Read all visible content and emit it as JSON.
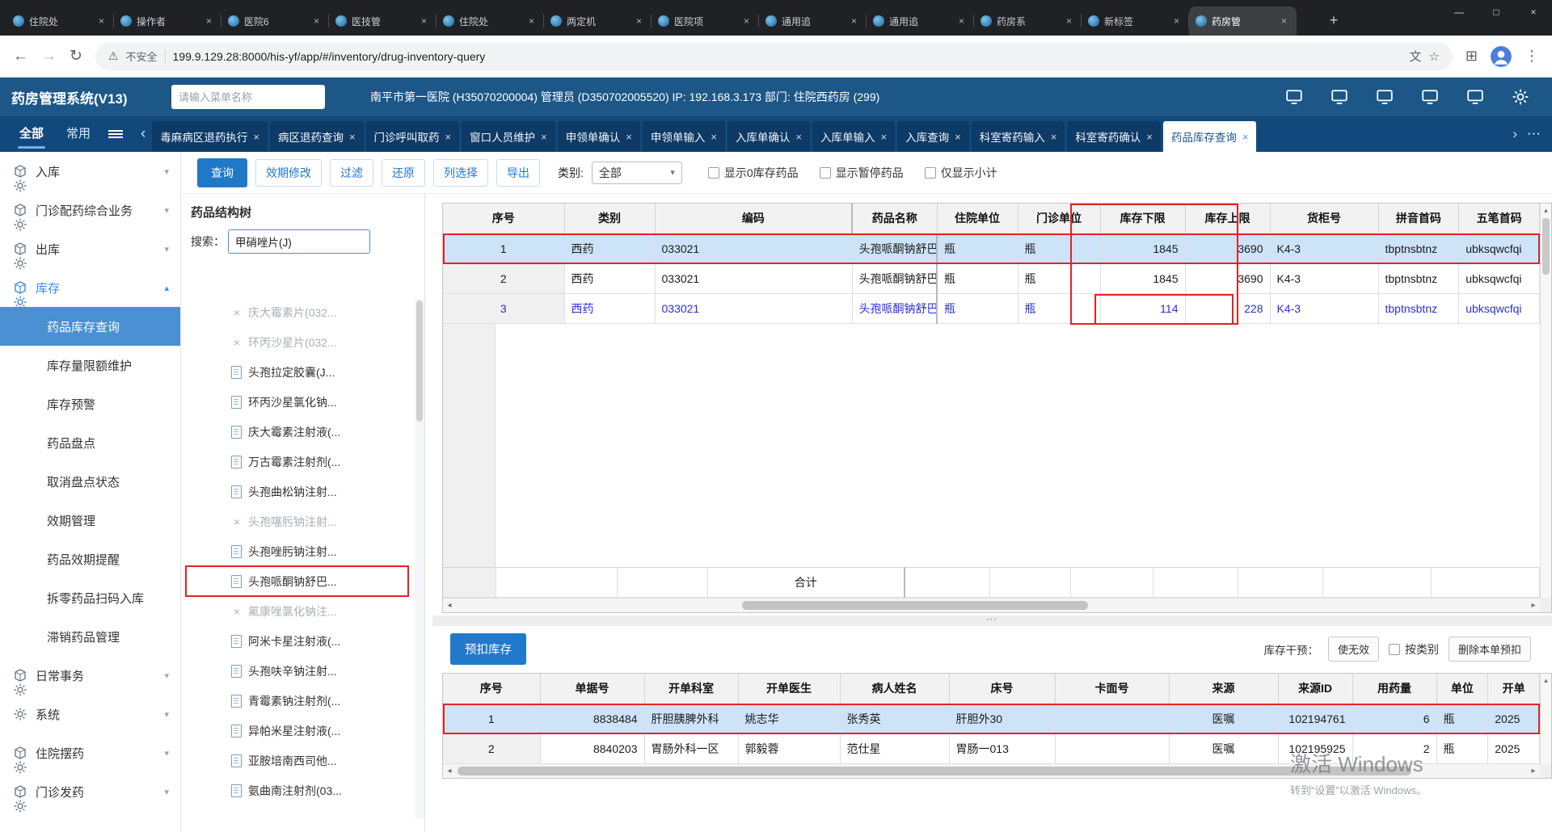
{
  "browser": {
    "tabs": [
      {
        "title": "住院处"
      },
      {
        "title": "操作者"
      },
      {
        "title": "医院6"
      },
      {
        "title": "医技管"
      },
      {
        "title": "住院处"
      },
      {
        "title": "两定机"
      },
      {
        "title": "医院项"
      },
      {
        "title": "通用追"
      },
      {
        "title": "通用追"
      },
      {
        "title": "药房系"
      },
      {
        "title": "新标签"
      },
      {
        "title": "药房管",
        "active": true
      }
    ],
    "new_tab_label": "+",
    "window_controls": {
      "minimize": "—",
      "maximize": "□",
      "close": "×"
    },
    "address": {
      "security_label": "不安全",
      "url": "199.9.129.28:8000/his-yf/app/#/inventory/drug-inventory-query"
    }
  },
  "icons": {
    "back": "←",
    "forward": "→",
    "refresh": "↻",
    "warning": "⚠",
    "star": "☆",
    "extensions": "⊞",
    "menu_dots": "⋮",
    "translate": "文",
    "caret_down": "▾",
    "chevron_left": "‹",
    "chevron_right": "›",
    "more": "⋯",
    "scroll_up": "▴",
    "scroll_left": "◂",
    "scroll_right": "▸"
  },
  "app_header": {
    "title": "药房管理系统(V13)",
    "menu_search_placeholder": "请输入菜单名称",
    "session_info": "南平市第一医院 (H35070200004) 管理员 (D350702005520) IP: 192.168.3.173 部门: 住院西药房 (299)",
    "icons": [
      {
        "name": "cast-icon"
      },
      {
        "name": "monitor-icon"
      },
      {
        "name": "voice-icon"
      },
      {
        "name": "kiosk-icon"
      },
      {
        "name": "browser-icon"
      },
      {
        "name": "settings-icon",
        "gear": true
      }
    ]
  },
  "menu_bar": {
    "filters": [
      {
        "label": "全部",
        "active": true
      },
      {
        "label": "常用"
      }
    ],
    "tabs": [
      {
        "label": "毒麻病区退药执行"
      },
      {
        "label": "病区退药查询"
      },
      {
        "label": "门诊呼叫取药"
      },
      {
        "label": "窗口人员维护"
      },
      {
        "label": "申领单确认"
      },
      {
        "label": "申领单输入"
      },
      {
        "label": "入库单确认"
      },
      {
        "label": "入库单输入"
      },
      {
        "label": "入库查询"
      },
      {
        "label": "科室寄药输入"
      },
      {
        "label": "科室寄药确认"
      },
      {
        "label": "药品库存查询",
        "active": true
      }
    ]
  },
  "sidebar": {
    "items": [
      {
        "label": "入库"
      },
      {
        "label": "门诊配药综合业务"
      },
      {
        "label": "出库"
      },
      {
        "label": "库存",
        "expanded": true
      },
      {
        "label": "药品库存查询",
        "sub": true,
        "active": true
      },
      {
        "label": "库存量限额维护",
        "sub": true
      },
      {
        "label": "库存预警",
        "sub": true
      },
      {
        "label": "药品盘点",
        "sub": true
      },
      {
        "label": "取消盘点状态",
        "sub": true
      },
      {
        "label": "效期管理",
        "sub": true
      },
      {
        "label": "药品效期提醒",
        "sub": true
      },
      {
        "label": "拆零药品扫码入库",
        "sub": true
      },
      {
        "label": "滞销药品管理",
        "sub": true
      },
      {
        "label": "日常事务"
      },
      {
        "label": "系统",
        "gear": true
      },
      {
        "label": "住院摆药"
      },
      {
        "label": "门诊发药"
      }
    ]
  },
  "toolbar": {
    "query": "查询",
    "expiry_edit": "效期修改",
    "filter": "过滤",
    "restore": "还原",
    "column_select": "列选择",
    "export": "导出",
    "category_label": "类别:",
    "category_value": "全部",
    "checkboxes": [
      {
        "label": "显示0库存药品"
      },
      {
        "label": "显示暂停药品"
      },
      {
        "label": "仅显示小计"
      }
    ]
  },
  "tree": {
    "title": "药品结构树",
    "search_label": "搜索：",
    "search_value": "甲硝唑片(J)",
    "items": [
      {
        "label": "庆大霉素片(032...",
        "x": true,
        "dim": true
      },
      {
        "label": "环丙沙星片(032...",
        "x": true,
        "dim": true
      },
      {
        "label": "头孢拉定胶囊(J..."
      },
      {
        "label": "环丙沙星氯化钠..."
      },
      {
        "label": "庆大霉素注射液(..."
      },
      {
        "label": "万古霉素注射剂(..."
      },
      {
        "label": "头孢曲松钠注射..."
      },
      {
        "label": "头孢噻肟钠注射...",
        "x": true,
        "dim": true
      },
      {
        "label": "头孢唑肟钠注射..."
      },
      {
        "label": "头孢哌酮钠舒巴...",
        "boxed": true
      },
      {
        "label": "氟康唑氯化钠注...",
        "x": true,
        "dim": true
      },
      {
        "label": "阿米卡星注射液(..."
      },
      {
        "label": "头孢呋辛钠注射..."
      },
      {
        "label": "青霉素钠注射剂(..."
      },
      {
        "label": "异帕米星注射液(..."
      },
      {
        "label": "亚胺培南西司他..."
      },
      {
        "label": "氨曲南注射剂(03..."
      }
    ]
  },
  "inventory_table": {
    "columns": [
      "序号",
      "类别",
      "编码",
      "药品名称",
      "住院单位",
      "门诊单位",
      "库存下限",
      "库存上限",
      "货柜号",
      "拼音首码",
      "五笔首码"
    ],
    "rows": [
      {
        "seq": "1",
        "category": "西药",
        "code": "033021",
        "name": "头孢哌酮钠舒巴坦钠注射...",
        "inpatient_unit": "瓶",
        "outpatient_unit": "瓶",
        "lower": "1845",
        "upper": "3690",
        "shelf": "K4-3",
        "pinyin": "tbptnsbtnz",
        "wubi": "ubksqwcfqi",
        "selected": true
      },
      {
        "seq": "2",
        "category": "西药",
        "code": "033021",
        "name": "头孢哌酮钠舒巴坦钠注射...",
        "inpatient_unit": "瓶",
        "outpatient_unit": "瓶",
        "lower": "1845",
        "upper": "3690",
        "shelf": "K4-3",
        "pinyin": "tbptnsbtnz",
        "wubi": "ubksqwcfqi"
      },
      {
        "seq": "3",
        "category": "西药",
        "code": "033021",
        "name": "头孢哌酮钠舒巴坦钠注射...",
        "inpatient_unit": "瓶",
        "outpatient_unit": "瓶",
        "lower": "114",
        "upper": "228",
        "shelf": "K4-3",
        "pinyin": "tbptnsbtnz",
        "wubi": "ubksqwcfqi",
        "blue": true
      }
    ],
    "total_label": "合计"
  },
  "withhold": {
    "button": "预扣库存",
    "intervention_label": "库存干预：",
    "invalidate": "使无效",
    "by_category": "按类别",
    "delete_withhold": "删除本单预扣"
  },
  "withhold_table": {
    "columns": [
      "序号",
      "单据号",
      "开单科室",
      "开单医生",
      "病人姓名",
      "床号",
      "卡面号",
      "来源",
      "来源ID",
      "用药量",
      "单位",
      "开单"
    ],
    "rows": [
      {
        "seq": "1",
        "doc_no": "8838484",
        "dept": "肝胆胰脾外科",
        "doctor": "姚志华",
        "patient": "张秀英",
        "bed": "肝胆外30",
        "card": "",
        "source": "医嘱",
        "source_id": "102194761",
        "qty": "6",
        "unit": "瓶",
        "order": "2025",
        "selected": true
      },
      {
        "seq": "2",
        "doc_no": "8840203",
        "dept": "胃肠外科一区",
        "doctor": "郭毅蓉",
        "patient": "范仕星",
        "bed": "胃肠一013",
        "card": "",
        "source": "医嘱",
        "source_id": "102195925",
        "qty": "2",
        "unit": "瓶",
        "order": "2025"
      }
    ]
  },
  "watermark": {
    "line1": "激活 Windows",
    "line2": "转到“设置”以激活 Windows。"
  },
  "colors": {
    "accent": "#1F78C8",
    "header_bar": "#1C5788",
    "menu_bar": "#12497C",
    "tab_inactive": "#0D3A66",
    "selected_row": "#CDE3F8",
    "annotation_red": "#E42222",
    "active_sidebar": "#4A90D2"
  }
}
